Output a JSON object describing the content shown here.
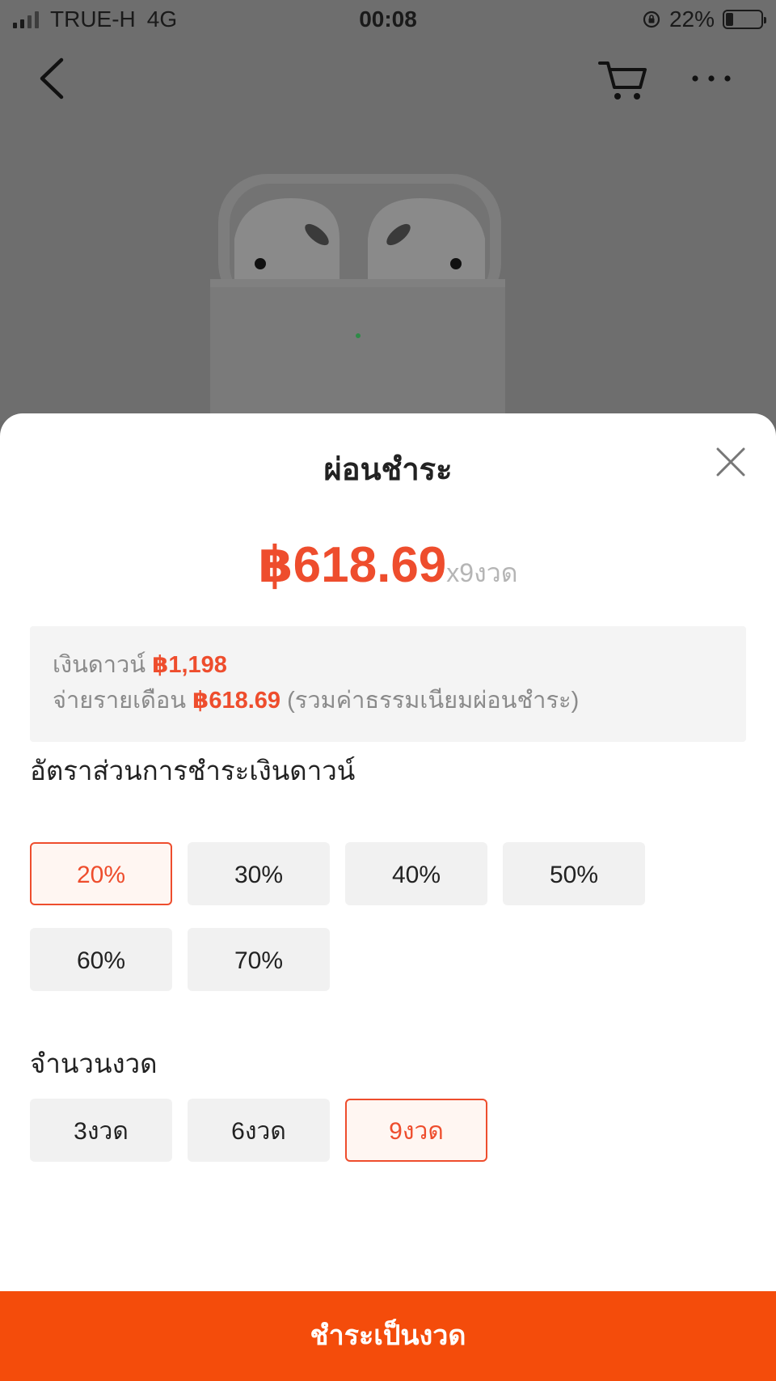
{
  "status_bar": {
    "carrier": "TRUE-H",
    "network": "4G",
    "time": "00:08",
    "battery": "22%",
    "battery_level": 0.22
  },
  "nav": {
    "back_icon": "chevron-left-icon",
    "cart_icon": "cart-icon",
    "more_icon": "more-horizontal-icon"
  },
  "sheet": {
    "title": "ผ่อนชำระ",
    "close_icon": "close-icon",
    "price": "฿618.69",
    "price_suffix": "x9งวด",
    "summary": {
      "down_label": "เงินดาวน์",
      "down_amount": "฿1,198",
      "monthly_label": "จ่ายรายเดือน",
      "monthly_amount": "฿618.69",
      "monthly_note": "(รวมค่าธรรมเนียมผ่อนชำระ)"
    },
    "down_section_label": "อัตราส่วนการชำระเงินดาวน์",
    "down_options": [
      "20%",
      "30%",
      "40%",
      "50%",
      "60%",
      "70%"
    ],
    "down_selected": "20%",
    "installment_section_label": "จำนวนงวด",
    "installment_options": [
      "3งวด",
      "6งวด",
      "9งวด"
    ],
    "installment_selected": "9งวด",
    "submit_label": "ชำระเป็นงวด"
  },
  "colors": {
    "accent": "#ee4d2d",
    "button": "#f44c0b",
    "overlay": "#6e6e6e"
  }
}
